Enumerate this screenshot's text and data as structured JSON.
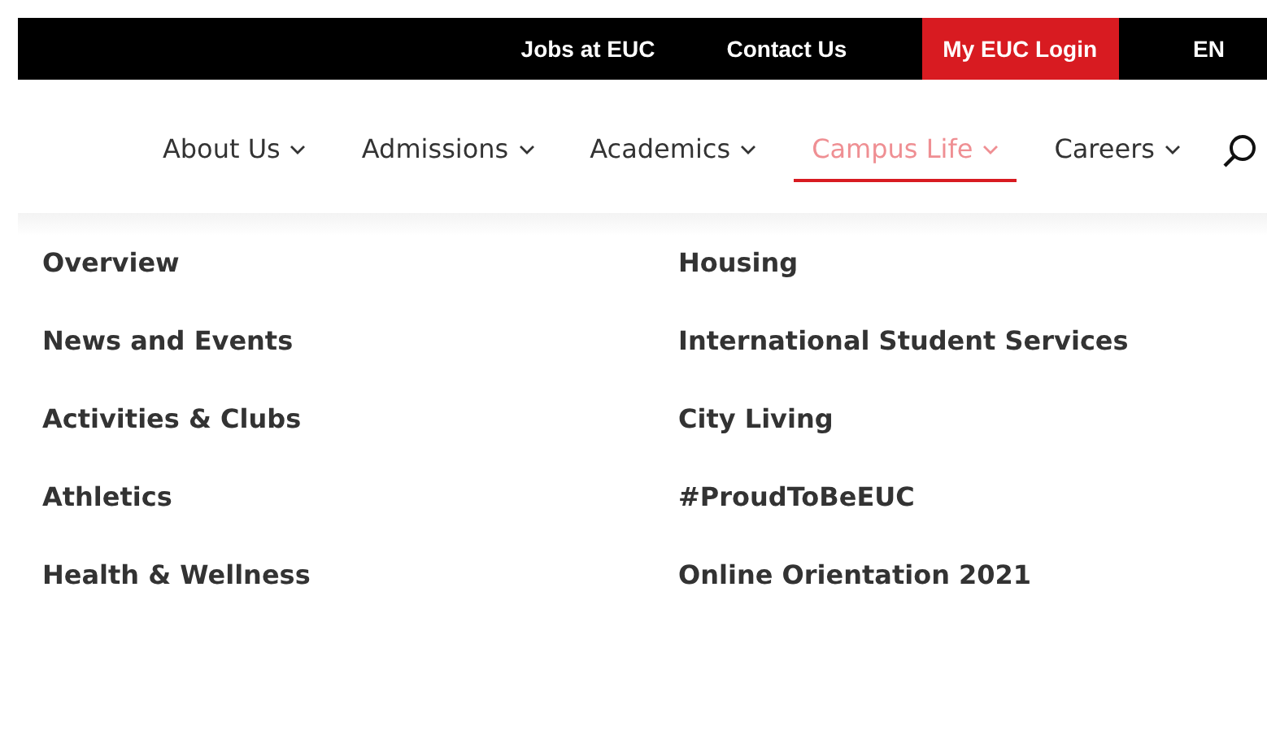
{
  "top_bar": {
    "links": [
      {
        "label": "Jobs at EUC",
        "kind": "plain"
      },
      {
        "label": "Contact Us",
        "kind": "plain"
      },
      {
        "label": "My EUC Login",
        "kind": "highlight"
      }
    ],
    "language": "EN"
  },
  "nav": {
    "items": [
      {
        "label": "About Us",
        "selected": false
      },
      {
        "label": "Admissions",
        "selected": false
      },
      {
        "label": "Academics",
        "selected": false
      },
      {
        "label": "Campus Life",
        "selected": true
      },
      {
        "label": "Careers",
        "selected": false
      }
    ]
  },
  "dropdown": {
    "columns": [
      [
        "Overview",
        "News and Events",
        "Activities & Clubs",
        "Athletics",
        "Health & Wellness"
      ],
      [
        "Housing",
        "International Student Services",
        "City Living",
        "#ProudToBeEUC",
        "Online Orientation 2021"
      ]
    ]
  }
}
